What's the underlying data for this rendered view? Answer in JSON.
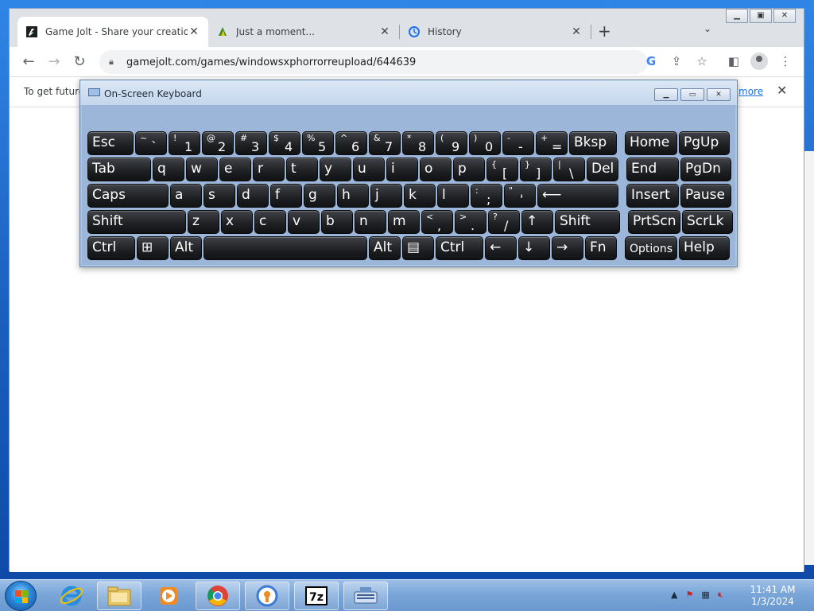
{
  "browser": {
    "tabs": [
      {
        "title": "Game Jolt - Share your creations",
        "icon": "gamejolt-icon",
        "active": true
      },
      {
        "title": "Just a moment...",
        "icon": "cloudflare-icon",
        "active": false
      },
      {
        "title": "History",
        "icon": "history-icon",
        "active": false
      }
    ],
    "new_tab_label": "+",
    "url": "gamejolt.com/games/windowsxphorrorreupload/644639",
    "infobar_message": "To get future",
    "infobar_link": "more",
    "infobar_close": "✕"
  },
  "osk": {
    "title": "On-Screen Keyboard",
    "rows": [
      [
        {
          "label": "Esc"
        },
        {
          "up": "~",
          "dn": "`"
        },
        {
          "up": "!",
          "dn": "1"
        },
        {
          "up": "@",
          "dn": "2"
        },
        {
          "up": "#",
          "dn": "3"
        },
        {
          "up": "$",
          "dn": "4"
        },
        {
          "up": "%",
          "dn": "5"
        },
        {
          "up": "^",
          "dn": "6"
        },
        {
          "up": "&",
          "dn": "7"
        },
        {
          "up": "*",
          "dn": "8"
        },
        {
          "up": "(",
          "dn": "9"
        },
        {
          "up": ")",
          "dn": "0"
        },
        {
          "up": "-",
          "dn": "-"
        },
        {
          "up": "+",
          "dn": "="
        },
        {
          "label": "Bksp"
        },
        {
          "label": "Home"
        },
        {
          "label": "PgUp"
        }
      ],
      [
        {
          "label": "Tab"
        },
        {
          "label": "q"
        },
        {
          "label": "w"
        },
        {
          "label": "e"
        },
        {
          "label": "r"
        },
        {
          "label": "t"
        },
        {
          "label": "y"
        },
        {
          "label": "u"
        },
        {
          "label": "i"
        },
        {
          "label": "o"
        },
        {
          "label": "p"
        },
        {
          "up": "{",
          "dn": "["
        },
        {
          "up": "}",
          "dn": "]"
        },
        {
          "up": "|",
          "dn": "\\"
        },
        {
          "label": "Del"
        },
        {
          "label": "End"
        },
        {
          "label": "PgDn"
        }
      ],
      [
        {
          "label": "Caps"
        },
        {
          "label": "a"
        },
        {
          "label": "s"
        },
        {
          "label": "d"
        },
        {
          "label": "f"
        },
        {
          "label": "g"
        },
        {
          "label": "h"
        },
        {
          "label": "j"
        },
        {
          "label": "k"
        },
        {
          "label": "l"
        },
        {
          "up": ":",
          "dn": ";"
        },
        {
          "up": "\"",
          "dn": "'"
        },
        {
          "label": "⟵"
        },
        {
          "label": "Insert"
        },
        {
          "label": "Pause"
        }
      ],
      [
        {
          "label": "Shift"
        },
        {
          "label": "z"
        },
        {
          "label": "x"
        },
        {
          "label": "c"
        },
        {
          "label": "v"
        },
        {
          "label": "b"
        },
        {
          "label": "n"
        },
        {
          "label": "m"
        },
        {
          "up": "<",
          "dn": ","
        },
        {
          "up": ">",
          "dn": "."
        },
        {
          "up": "?",
          "dn": "/"
        },
        {
          "label": "↑"
        },
        {
          "label": "Shift"
        },
        {
          "label": "PrtScn"
        },
        {
          "label": "ScrLk"
        }
      ],
      [
        {
          "label": "Ctrl"
        },
        {
          "label": "⊞"
        },
        {
          "label": "Alt"
        },
        {
          "label": ""
        },
        {
          "label": "Alt"
        },
        {
          "label": "▤"
        },
        {
          "label": "Ctrl"
        },
        {
          "label": "←"
        },
        {
          "label": "↓"
        },
        {
          "label": "→"
        },
        {
          "label": "Fn"
        },
        {
          "label": "Options",
          "small": true
        },
        {
          "label": "Help"
        }
      ]
    ]
  },
  "taskbar": {
    "apps": [
      "internet-explorer",
      "file-explorer",
      "media-player",
      "chrome",
      "avast",
      "7-zip",
      "on-screen-keyboard"
    ],
    "clock_time": "11:41 AM",
    "clock_date": "1/3/2024"
  },
  "colors": {
    "osk_key": "#1d1f22",
    "osk_frame": "#a9c2e0",
    "tabstrip": "#dee1e6",
    "link": "#1a73e8"
  }
}
